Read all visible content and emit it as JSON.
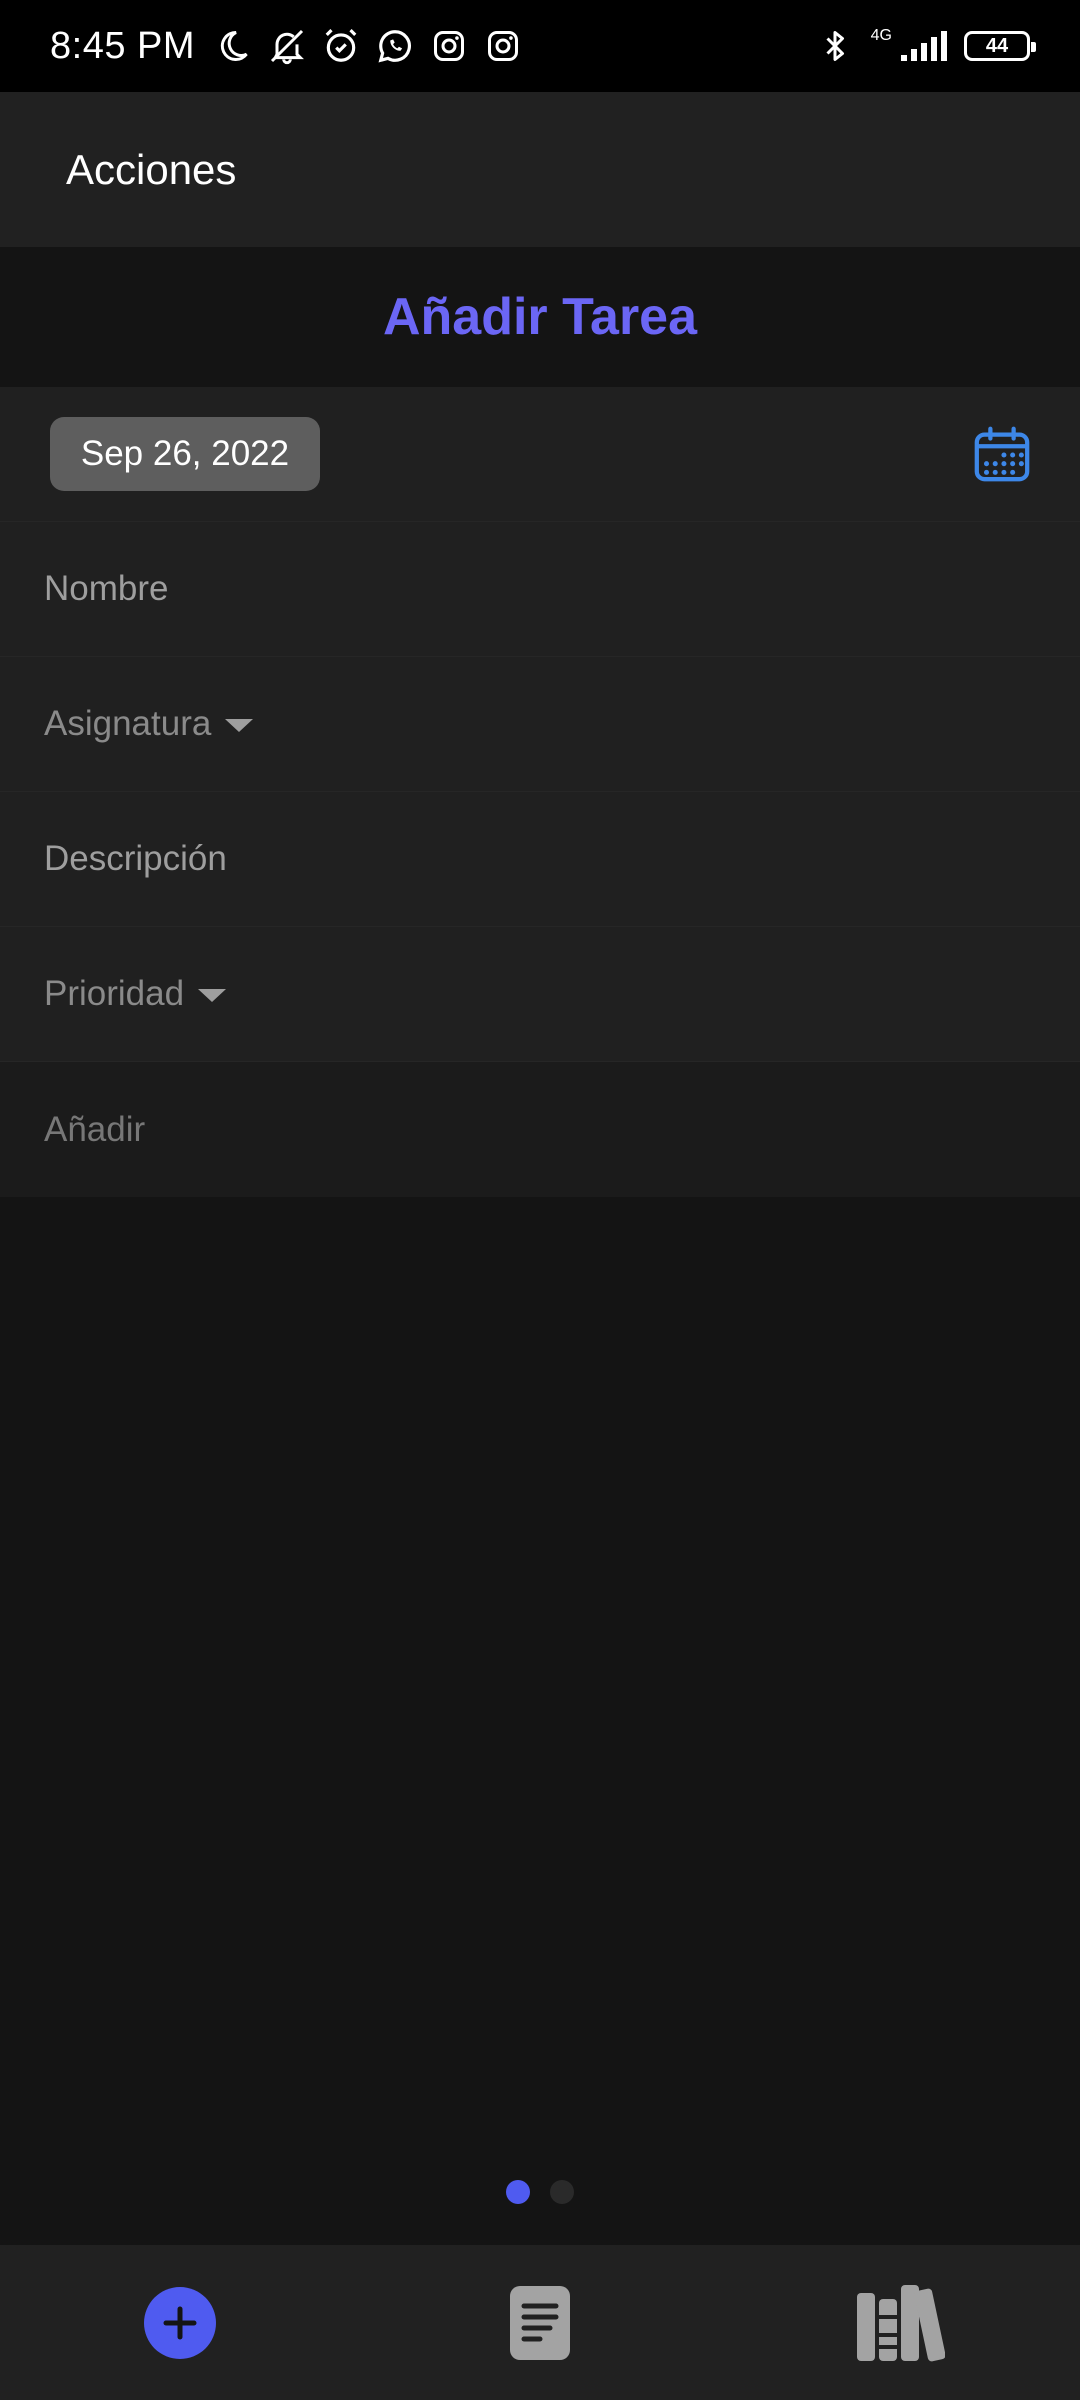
{
  "status_bar": {
    "time": "8:45 PM",
    "network": "4G",
    "battery": "44",
    "icons": [
      "moon-icon",
      "mute-icon",
      "alarm-icon",
      "whatsapp-icon",
      "instagram-icon",
      "instagram-icon",
      "bluetooth-icon",
      "signal-icon",
      "battery-icon"
    ]
  },
  "app_bar": {
    "title": "Acciones"
  },
  "form": {
    "heading": "Añadir Tarea",
    "date": "Sep 26, 2022",
    "name_placeholder": "Nombre",
    "subject_placeholder": "Asignatura",
    "description_placeholder": "Descripción",
    "priority_placeholder": "Prioridad",
    "add_label": "Añadir"
  },
  "page_indicator": {
    "total": 2,
    "active": 1
  },
  "bottom_nav": {
    "items": [
      {
        "icon": "add-circle-icon",
        "active": true
      },
      {
        "icon": "document-icon",
        "active": false
      },
      {
        "icon": "library-icon",
        "active": false
      }
    ]
  },
  "colors": {
    "accent": "#6b66f5",
    "nav_active": "#4f5bf0",
    "calendar_icon": "#3d87e8",
    "background": "#141414",
    "surface": "#202020"
  }
}
